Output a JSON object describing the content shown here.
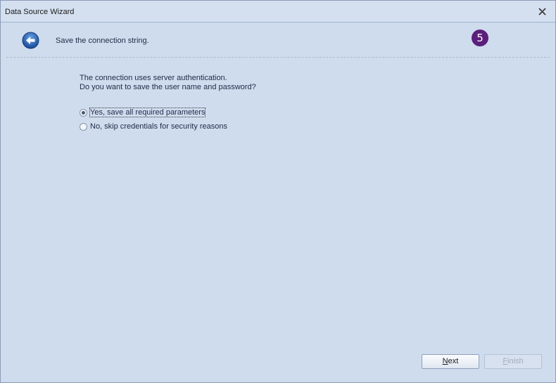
{
  "window": {
    "title": "Data Source Wizard"
  },
  "header": {
    "text": "Save the connection string.",
    "step": "5"
  },
  "body": {
    "line1": "The connection uses server authentication.",
    "line2": "Do you want to save the user name and password?"
  },
  "options": [
    {
      "label": "Yes, save all required parameters",
      "checked": true
    },
    {
      "label": "No, skip credentials for security reasons",
      "checked": false
    }
  ],
  "buttons": {
    "next_access": "N",
    "next_rest": "ext",
    "finish_access": "F",
    "finish_rest": "inish"
  },
  "colors": {
    "step_badge": "#5a1f7a",
    "background": "#cfdcee"
  }
}
